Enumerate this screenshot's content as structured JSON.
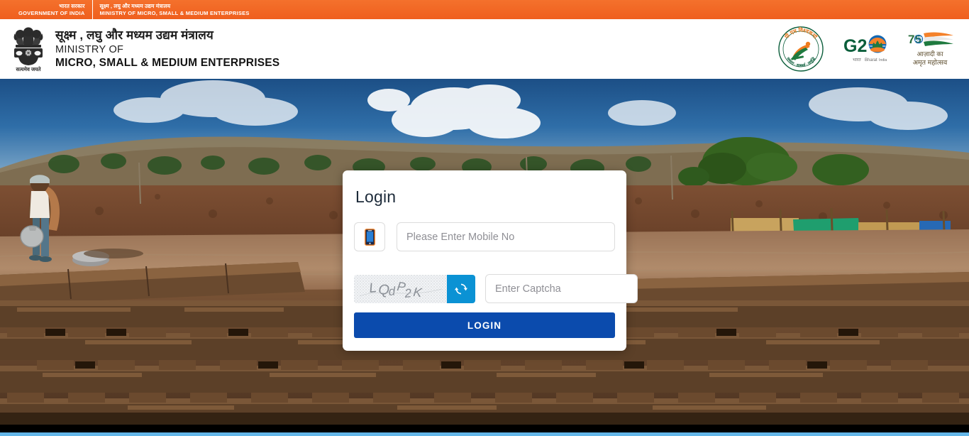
{
  "gov_bar": {
    "left_hi": "भारत सरकार",
    "left_en": "GOVERNMENT OF INDIA",
    "right_hi": "सूक्ष्म , लघु और मध्यम उद्यम मंत्रालय",
    "right_en": "MINISTRY OF MICRO, SMALL & MEDIUM ENTERPRISES",
    "bg_color": "#f26522"
  },
  "header": {
    "emblem_name": "national-emblem-of-india",
    "emblem_motto": "सत्यमेव जयते",
    "title_hi": "सूक्ष्म , लघु और मध्यम उद्यम मंत्रालय",
    "title_en_line1": "MINISTRY OF",
    "title_en_line2": "MICRO, SMALL & MEDIUM ENTERPRISES",
    "logos": [
      {
        "name": "pm-vishwakarma-logo",
        "text": "पी एम विश्वकर्मा",
        "sub": "सम्मान · सामर्थ्य · समृद्धि"
      },
      {
        "name": "g20-india-logo",
        "text": "G20",
        "sub": "भारत  Bharat  India"
      },
      {
        "name": "azadi-ka-amrit-mahotsav-logo",
        "text": "75",
        "sub_line1": "आज़ादी का",
        "sub_line2": "अमृत महोत्सव"
      }
    ]
  },
  "hero": {
    "name": "brick-kiln-workers-photo",
    "alt": "Brick kiln site with workers and stacked mud bricks"
  },
  "login": {
    "title": "Login",
    "mobile_icon": "mobile-phone-icon",
    "mobile_placeholder": "Please Enter Mobile No",
    "mobile_value": "",
    "captcha_text": "LQdP2K",
    "captcha_refresh_icon": "refresh-icon",
    "captcha_placeholder": "Enter Captcha",
    "captcha_value": "",
    "submit_label": "LOGIN",
    "submit_color": "#0b4bad",
    "refresh_color": "#0b92d4"
  },
  "footer": {
    "accent_color": "#63b6e8"
  }
}
